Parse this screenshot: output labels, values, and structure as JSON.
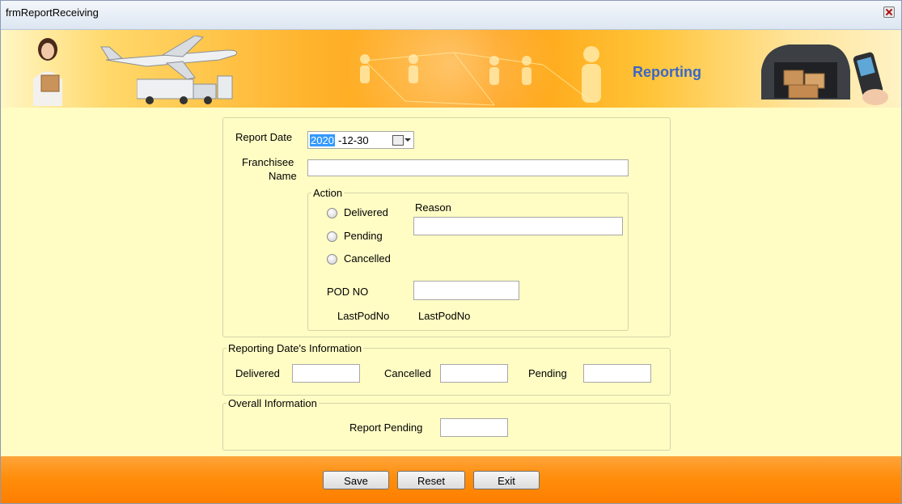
{
  "window": {
    "title": "frmReportReceiving"
  },
  "banner": {
    "title": "Reporting"
  },
  "form": {
    "report_date_label": "Report Date",
    "report_date_selected": "2020",
    "report_date_rest": "-12-30",
    "franchisee_label_line1": "Franchisee",
    "franchisee_label_line2": "Name",
    "franchisee_value": "",
    "action": {
      "legend": "Action",
      "options": [
        "Delivered",
        "Pending",
        "Cancelled"
      ],
      "reason_label": "Reason",
      "reason_value": "",
      "pod_label": "POD NO",
      "pod_value": "",
      "last_pod_label": "LastPodNo",
      "last_pod_value": "LastPodNo"
    }
  },
  "reporting_info": {
    "legend": "Reporting Date's Information",
    "delivered_label": "Delivered",
    "cancelled_label": "Cancelled",
    "pending_label": "Pending",
    "delivered_value": "",
    "cancelled_value": "",
    "pending_value": ""
  },
  "overall_info": {
    "legend": "Overall Information",
    "report_pending_label": "Report Pending",
    "report_pending_value": ""
  },
  "buttons": {
    "save": "Save",
    "reset": "Reset",
    "exit": "Exit"
  },
  "colors": {
    "background": "#fffdc4",
    "footer": "#ff8e0c",
    "accent_text": "#3a67c6"
  },
  "icons": [
    "close-icon",
    "calendar-icon",
    "chevron-down-icon",
    "woman-with-box-icon",
    "airplane-icon",
    "truck-icon",
    "delivery-van-icon",
    "handheld-scanner-icon"
  ]
}
